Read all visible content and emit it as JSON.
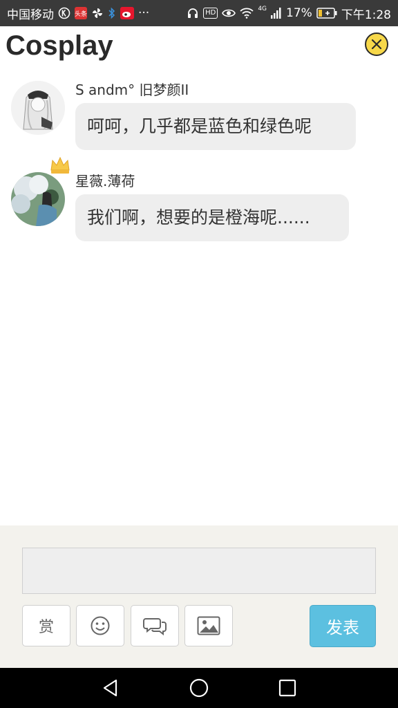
{
  "status_bar": {
    "carrier": "中国移动",
    "more": "···",
    "network": "4G",
    "battery": "17%",
    "time": "下午1:28",
    "badge_text": "头条",
    "hd_text": "HD"
  },
  "header": {
    "title": "Cosplay",
    "close_icon": "close-icon"
  },
  "messages": [
    {
      "sender": "S andm° 旧梦颜II",
      "text": "呵呵，几乎都是蓝色和绿色呢"
    },
    {
      "sender": "星薇.薄荷",
      "text": "我们啊，想要的是橙海呢......"
    }
  ],
  "composer": {
    "input_value": "",
    "reward_label": "赏",
    "send_label": "发表",
    "tools": [
      "emoji-icon",
      "chat-icon",
      "image-icon"
    ]
  },
  "colors": {
    "status_bar": "#3a3a3a",
    "close_button": "#f7d84a",
    "bubble": "#eeeeee",
    "send_button": "#5cc0e0",
    "composer_bg": "#f3f2ed"
  }
}
